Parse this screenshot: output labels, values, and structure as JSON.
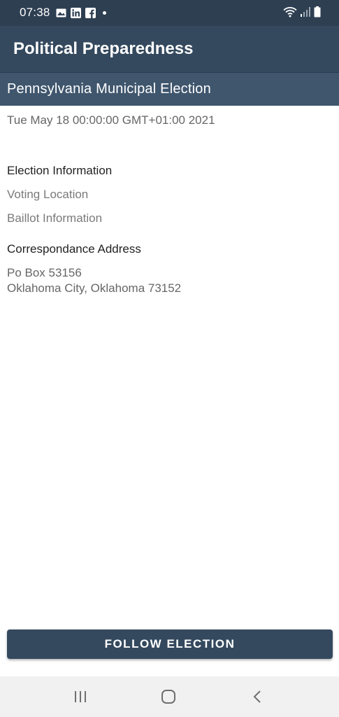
{
  "status_bar": {
    "time": "07:38",
    "icons_left": [
      "gallery-icon",
      "linkedin-icon",
      "facebook-icon",
      "notification-dot-icon"
    ],
    "icons_right": [
      "wifi-icon",
      "signal-icon",
      "battery-icon"
    ]
  },
  "app_bar": {
    "title": "Political Preparedness"
  },
  "election": {
    "name": "Pennsylvania Municipal Election",
    "date": "Tue May 18 00:00:00 GMT+01:00 2021"
  },
  "election_info": {
    "heading": "Election Information",
    "voting_location": "Voting Location",
    "ballot_information": "Baillot Information"
  },
  "correspondence": {
    "heading": "Correspondance Address",
    "line1": "Po Box 53156",
    "line2": "Oklahoma City, Oklahoma 73152"
  },
  "actions": {
    "follow_label": "FOLLOW ELECTION"
  },
  "nav_bar": {
    "icons": [
      "recents-icon",
      "home-icon",
      "back-icon"
    ]
  },
  "colors": {
    "primary": "#34495e",
    "primary_dark": "#2e3f52",
    "header": "#3f566d"
  }
}
